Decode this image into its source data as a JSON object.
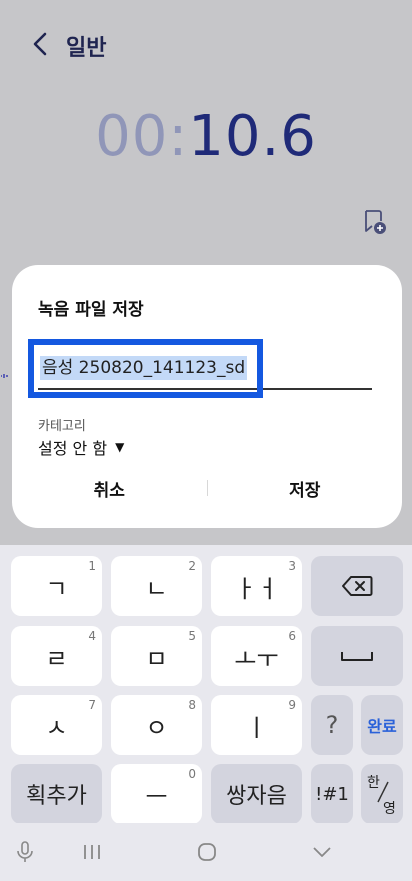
{
  "app": {
    "title": "일반",
    "timer": {
      "minutes": "00",
      "separator": ":",
      "seconds": "10.6"
    }
  },
  "dialog": {
    "title": "녹음 파일 저장",
    "file_name": "음성 250820_141123_sd",
    "category_label": "카테고리",
    "category_value": "설정 안 함",
    "cancel_label": "취소",
    "save_label": "저장"
  },
  "keyboard": {
    "rows": [
      [
        {
          "label": "ㄱ",
          "num": "1"
        },
        {
          "label": "ㄴ",
          "num": "2"
        },
        {
          "label": "ㅏㅓ",
          "num": "3"
        },
        {
          "label": "backspace-icon"
        }
      ],
      [
        {
          "label": "ㄹ",
          "num": "4"
        },
        {
          "label": "ㅁ",
          "num": "5"
        },
        {
          "label": "ㅗㅜ",
          "num": "6"
        },
        {
          "label": "space-icon"
        }
      ],
      [
        {
          "label": "ㅅ",
          "num": "7"
        },
        {
          "label": "ㅇ",
          "num": "8"
        },
        {
          "label": "ㅣ",
          "num": "9"
        },
        {
          "label": "?"
        },
        {
          "label": "완료"
        }
      ],
      [
        {
          "label": "획추가"
        },
        {
          "label": "ㅡ",
          "num": "0"
        },
        {
          "label": "쌍자음"
        },
        {
          "label": "!#1"
        },
        {
          "label": "한/영"
        }
      ]
    ],
    "lang_top": "한",
    "lang_bottom": "영"
  },
  "colors": {
    "accent_focus": "#1458e0",
    "timer_active": "#1f2a78",
    "timer_dim": "#9096b8",
    "done_key": "#2b62d9"
  }
}
